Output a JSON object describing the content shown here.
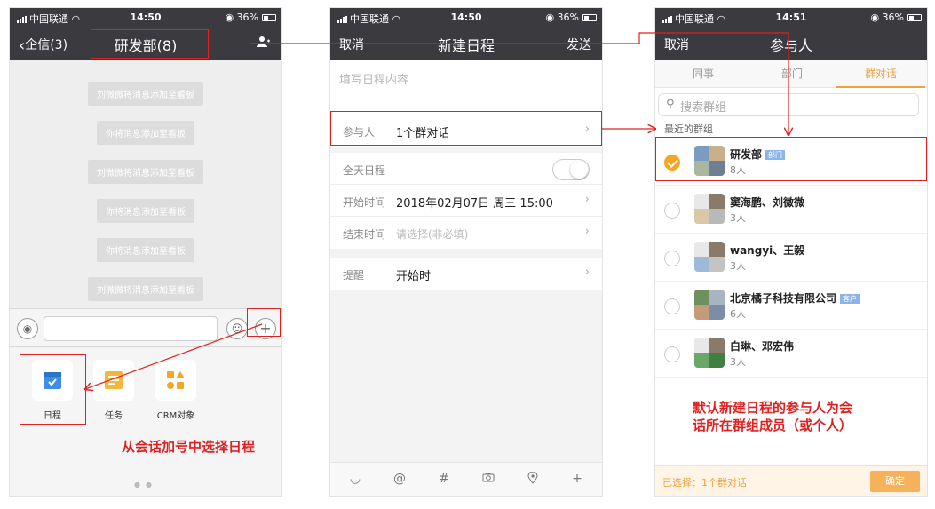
{
  "status_bar": {
    "carrier": "中国联通",
    "battery": "36%",
    "p1_time": "14:50",
    "p2_time": "14:50",
    "p3_time": "14:51"
  },
  "chat": {
    "back_label": "企信(3)",
    "title": "研发部(8)",
    "system_messages": [
      "刘微微将消息添加至看板",
      "你将消息添加至看板",
      "刘微微将消息添加至看板",
      "你将消息添加至看板",
      "你将消息添加至看板",
      "刘微微将消息添加至看板"
    ],
    "tiles": [
      "日程",
      "任务",
      "CRM对象"
    ],
    "annotation": "从会话加号中选择日程"
  },
  "schedule": {
    "cancel": "取消",
    "title": "新建日程",
    "send": "发送",
    "content_placeholder": "填写日程内容",
    "participants_label": "参与人",
    "participants_value": "1个群对话",
    "allday_label": "全天日程",
    "start_label": "开始时间",
    "start_value": "2018年02月07日 周三 15:00",
    "end_label": "结束时间",
    "end_placeholder": "请选择(非必填)",
    "remind_label": "提醒",
    "remind_value": "开始时",
    "toolbar_icons": [
      "smile-icon",
      "at-icon",
      "hash-icon",
      "camera-icon",
      "location-icon",
      "plus-icon"
    ]
  },
  "participants": {
    "cancel": "取消",
    "title": "参与人",
    "tabs": [
      "同事",
      "部门",
      "群对话"
    ],
    "active_tab": "群对话",
    "search_placeholder": "搜索群组",
    "section_title": "最近的群组",
    "groups": [
      {
        "name": "研发部",
        "tag": "部门",
        "count": "8人",
        "checked": true
      },
      {
        "name": "窦海鹏、刘微微",
        "tag": "",
        "count": "3人",
        "checked": false
      },
      {
        "name": "wangyi、王毅",
        "tag": "",
        "count": "3人",
        "checked": false
      },
      {
        "name": "北京橘子科技有限公司",
        "tag": "客户",
        "count": "6人",
        "checked": false
      },
      {
        "name": "白琳、邓宏伟",
        "tag": "",
        "count": "3人",
        "checked": false
      }
    ],
    "selected_text": "已选择：1个群对话",
    "confirm": "确定",
    "annotation_line1": "默认新建日程的参与人为会",
    "annotation_line2": "话所在群组成员（或个人）"
  },
  "colors": {
    "nav": "#3a3a3f",
    "accent": "#f5a623",
    "annotation": "#e02020",
    "tag": "#8db4e6"
  }
}
